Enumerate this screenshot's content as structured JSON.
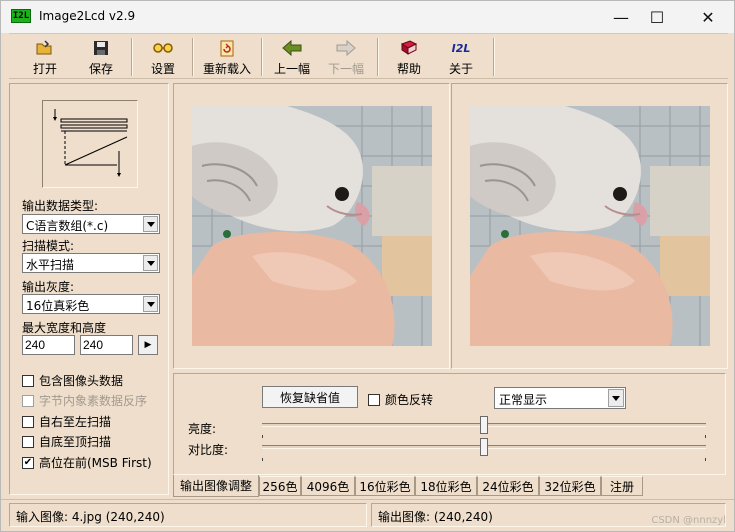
{
  "window": {
    "title": "Image2Lcd v2.9",
    "app_icon_text": "I2L",
    "controls": {
      "minimize": "—",
      "maximize": "☐",
      "close": "✕"
    }
  },
  "toolbar": {
    "items": [
      {
        "label": "打开",
        "icon": "open-folder-icon",
        "enabled": true
      },
      {
        "label": "保存",
        "icon": "floppy-disk-icon",
        "enabled": true
      },
      {
        "label": "设置",
        "icon": "glasses-icon",
        "enabled": true
      },
      {
        "label": "重新载入",
        "icon": "reload-document-icon",
        "enabled": true
      },
      {
        "label": "上一幅",
        "icon": "arrow-left-icon",
        "enabled": true
      },
      {
        "label": "下一幅",
        "icon": "arrow-right-icon",
        "enabled": false
      },
      {
        "label": "帮助",
        "icon": "help-book-icon",
        "enabled": true
      },
      {
        "label": "关于",
        "icon": "i2l-logo-icon",
        "enabled": true
      }
    ],
    "about_icon_text": "I2L"
  },
  "settings": {
    "output_type_label": "输出数据类型:",
    "output_type_value": "C语言数组(*.c)",
    "scan_mode_label": "扫描模式:",
    "scan_mode_value": "水平扫描",
    "gray_label": "输出灰度:",
    "gray_value": "16位真彩色",
    "size_label": "最大宽度和高度",
    "max_width": "240",
    "max_height": "240",
    "checkboxes": [
      {
        "label": "包含图像头数据",
        "checked": false,
        "enabled": true
      },
      {
        "label": "字节内象素数据反序",
        "checked": false,
        "enabled": false
      },
      {
        "label": "自右至左扫描",
        "checked": false,
        "enabled": true
      },
      {
        "label": "自底至顶扫描",
        "checked": false,
        "enabled": true
      },
      {
        "label": "高位在前(MSB First)",
        "checked": true,
        "enabled": true
      }
    ]
  },
  "adjust": {
    "restore_default_label": "恢复缺省值",
    "invert_color_label": "颜色反转",
    "invert_checked": false,
    "display_mode_value": "正常显示",
    "brightness_label": "亮度:",
    "contrast_label": "对比度:",
    "brightness_level": 0.5,
    "contrast_level": 0.5
  },
  "tabs": [
    {
      "label": "输出图像调整",
      "active": true
    },
    {
      "label": "256色",
      "active": false
    },
    {
      "label": "4096色",
      "active": false
    },
    {
      "label": "16位彩色",
      "active": false
    },
    {
      "label": "18位彩色",
      "active": false
    },
    {
      "label": "24位彩色",
      "active": false
    },
    {
      "label": "32位彩色",
      "active": false
    },
    {
      "label": "注册",
      "active": false
    }
  ],
  "status": {
    "input_image": "输入图像: 4.jpg (240,240)",
    "output_image": "输出图像: (240,240)"
  },
  "watermark": "CSDN @nnnzyl",
  "colors": {
    "panel_bg": "#eedecb",
    "titlebar_bg": "#f3f3f3",
    "arrow_green": "#6b8e23"
  }
}
